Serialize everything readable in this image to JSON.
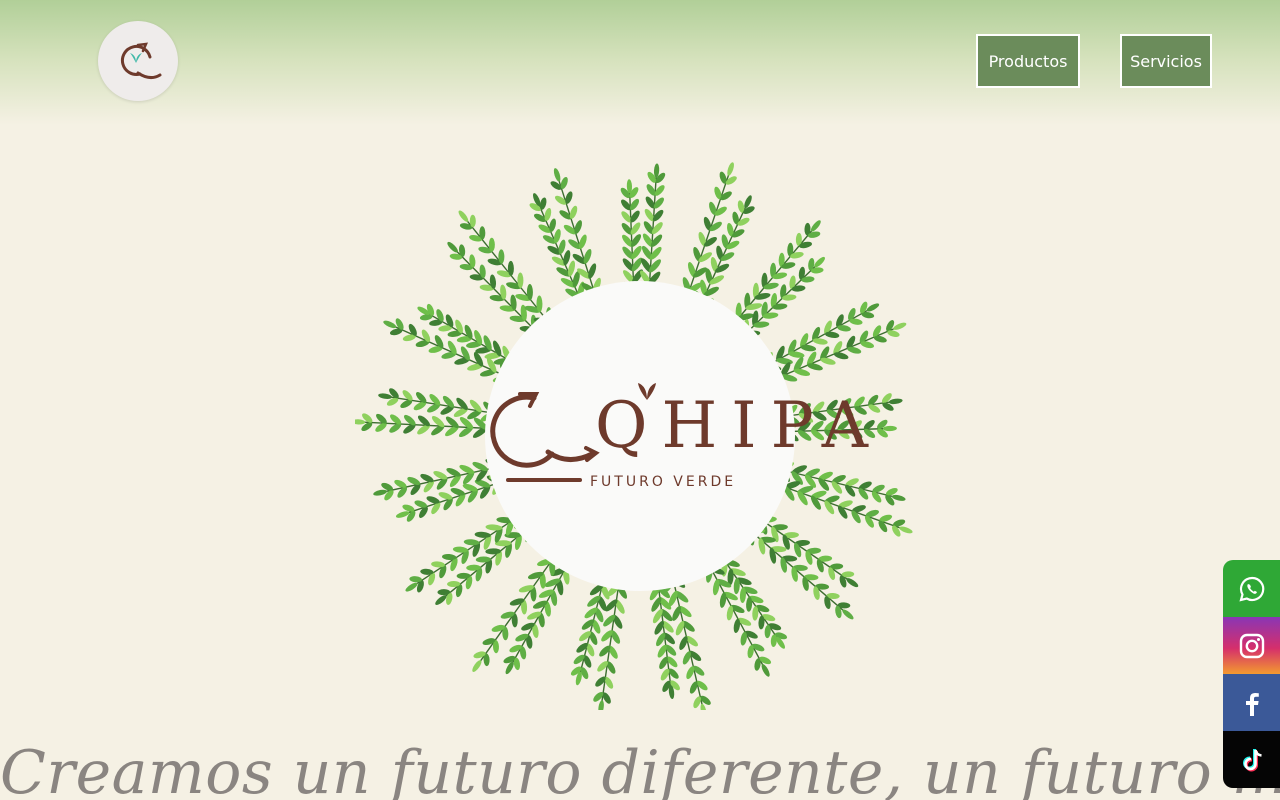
{
  "header": {
    "logo_icon": "qhipa-logo-icon",
    "nav": [
      {
        "label": "Productos"
      },
      {
        "label": "Servicios"
      }
    ]
  },
  "hero": {
    "brand_name": "QHIPA",
    "brand_tagline": "FUTURO VERDE",
    "decoration": "olive-branch-wreath"
  },
  "tagline": "Creamos un futuro diferente, un futuro más",
  "social": [
    {
      "name": "whatsapp-icon",
      "color": "#2fa836"
    },
    {
      "name": "instagram-icon",
      "color": "#c13584"
    },
    {
      "name": "facebook-icon",
      "color": "#3b5998"
    },
    {
      "name": "tiktok-icon",
      "color": "#050505"
    }
  ],
  "colors": {
    "brand_brown": "#6e3a2c",
    "nav_green": "#6b8c5b",
    "leaf_green": "#6fbf4a",
    "background": "#f5f1e4"
  }
}
